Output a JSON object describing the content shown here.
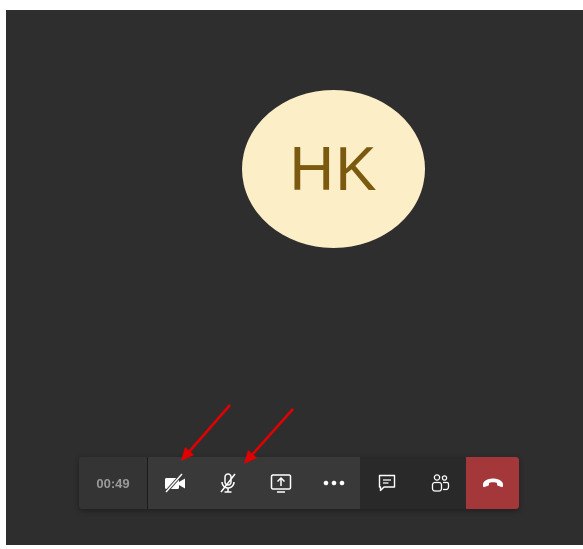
{
  "participant": {
    "initials": "HK"
  },
  "toolbar": {
    "timer": "00:49",
    "buttons": [
      {
        "name": "camera-off-button",
        "icon": "video-off-icon"
      },
      {
        "name": "mic-off-button",
        "icon": "mic-off-icon"
      },
      {
        "name": "share-screen-button",
        "icon": "share-screen-icon"
      },
      {
        "name": "more-actions-button",
        "icon": "more-icon"
      },
      {
        "name": "chat-button",
        "icon": "chat-icon"
      },
      {
        "name": "participants-button",
        "icon": "people-icon"
      },
      {
        "name": "hang-up-button",
        "icon": "phone-hangup-icon"
      }
    ]
  },
  "colors": {
    "stage_background": "#2f2e2e",
    "avatar_background": "#fcefc8",
    "avatar_text": "#7b5a0f",
    "hangup": "#a4373a",
    "annotation_arrow": "#e00000"
  }
}
